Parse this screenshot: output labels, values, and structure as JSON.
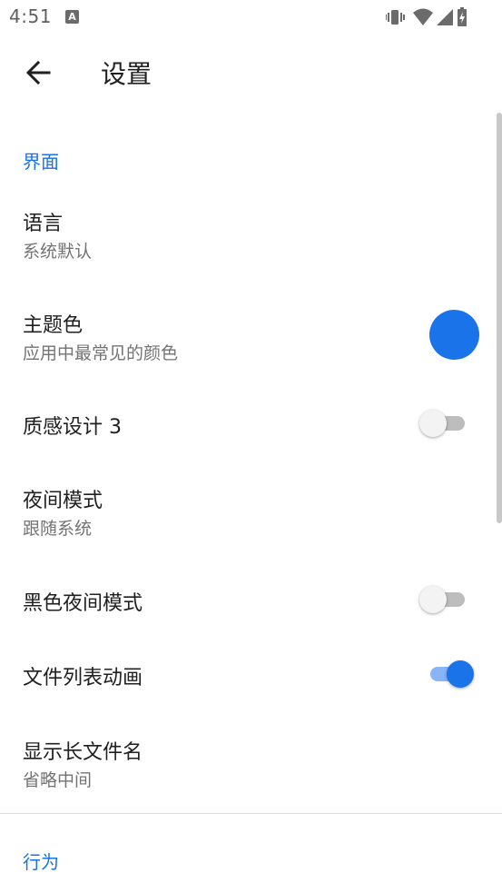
{
  "status_bar": {
    "time": "4:51",
    "notification_icon": "A",
    "icons": [
      "vibrate-icon",
      "wifi-icon",
      "signal-icon",
      "battery-charging-icon"
    ]
  },
  "app_bar": {
    "back_icon": "arrow-left-icon",
    "title": "设置"
  },
  "sections": {
    "interface": {
      "header": "界面",
      "items": [
        {
          "title": "语言",
          "summary": "系统默认"
        },
        {
          "title": "主题色",
          "summary": "应用中最常见的颜色",
          "color": "#1a73e8"
        },
        {
          "title": "质感设计 3",
          "switch": false
        },
        {
          "title": "夜间模式",
          "summary": "跟随系统"
        },
        {
          "title": "黑色夜间模式",
          "switch": false
        },
        {
          "title": "文件列表动画",
          "switch": true
        },
        {
          "title": "显示长文件名",
          "summary": "省略中间"
        }
      ]
    },
    "behavior": {
      "header": "行为"
    }
  },
  "colors": {
    "accent": "#1a73e8",
    "accent_track": "#8ab4f8",
    "text_primary": "#202020",
    "text_secondary": "#737373"
  }
}
